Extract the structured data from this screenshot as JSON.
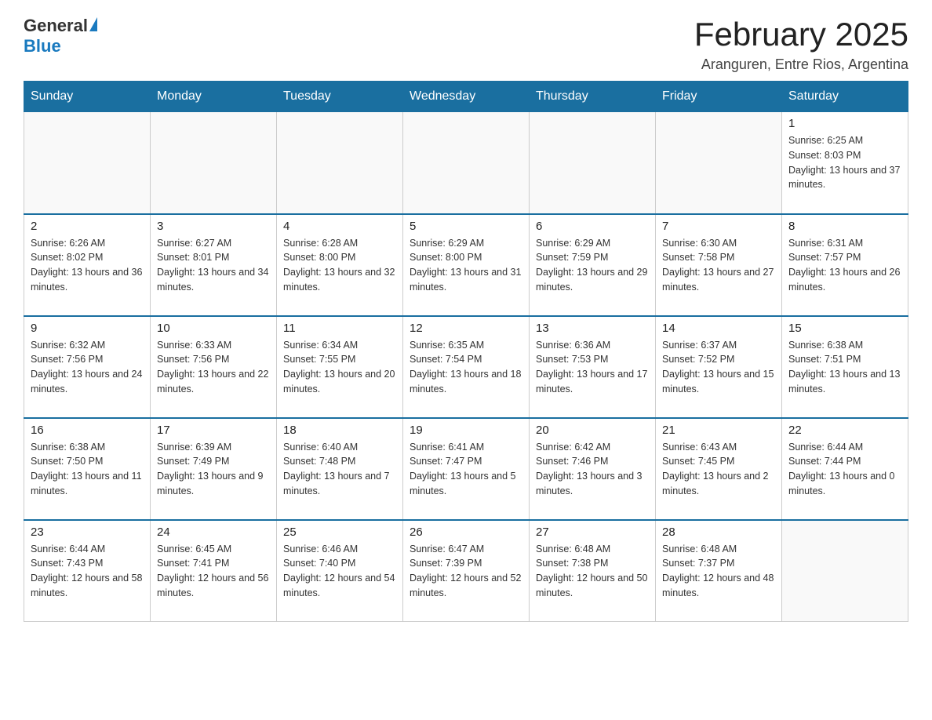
{
  "logo": {
    "general": "General",
    "blue": "Blue"
  },
  "header": {
    "title": "February 2025",
    "location": "Aranguren, Entre Rios, Argentina"
  },
  "weekdays": [
    "Sunday",
    "Monday",
    "Tuesday",
    "Wednesday",
    "Thursday",
    "Friday",
    "Saturday"
  ],
  "weeks": [
    [
      {
        "day": "",
        "info": ""
      },
      {
        "day": "",
        "info": ""
      },
      {
        "day": "",
        "info": ""
      },
      {
        "day": "",
        "info": ""
      },
      {
        "day": "",
        "info": ""
      },
      {
        "day": "",
        "info": ""
      },
      {
        "day": "1",
        "info": "Sunrise: 6:25 AM\nSunset: 8:03 PM\nDaylight: 13 hours and 37 minutes."
      }
    ],
    [
      {
        "day": "2",
        "info": "Sunrise: 6:26 AM\nSunset: 8:02 PM\nDaylight: 13 hours and 36 minutes."
      },
      {
        "day": "3",
        "info": "Sunrise: 6:27 AM\nSunset: 8:01 PM\nDaylight: 13 hours and 34 minutes."
      },
      {
        "day": "4",
        "info": "Sunrise: 6:28 AM\nSunset: 8:00 PM\nDaylight: 13 hours and 32 minutes."
      },
      {
        "day": "5",
        "info": "Sunrise: 6:29 AM\nSunset: 8:00 PM\nDaylight: 13 hours and 31 minutes."
      },
      {
        "day": "6",
        "info": "Sunrise: 6:29 AM\nSunset: 7:59 PM\nDaylight: 13 hours and 29 minutes."
      },
      {
        "day": "7",
        "info": "Sunrise: 6:30 AM\nSunset: 7:58 PM\nDaylight: 13 hours and 27 minutes."
      },
      {
        "day": "8",
        "info": "Sunrise: 6:31 AM\nSunset: 7:57 PM\nDaylight: 13 hours and 26 minutes."
      }
    ],
    [
      {
        "day": "9",
        "info": "Sunrise: 6:32 AM\nSunset: 7:56 PM\nDaylight: 13 hours and 24 minutes."
      },
      {
        "day": "10",
        "info": "Sunrise: 6:33 AM\nSunset: 7:56 PM\nDaylight: 13 hours and 22 minutes."
      },
      {
        "day": "11",
        "info": "Sunrise: 6:34 AM\nSunset: 7:55 PM\nDaylight: 13 hours and 20 minutes."
      },
      {
        "day": "12",
        "info": "Sunrise: 6:35 AM\nSunset: 7:54 PM\nDaylight: 13 hours and 18 minutes."
      },
      {
        "day": "13",
        "info": "Sunrise: 6:36 AM\nSunset: 7:53 PM\nDaylight: 13 hours and 17 minutes."
      },
      {
        "day": "14",
        "info": "Sunrise: 6:37 AM\nSunset: 7:52 PM\nDaylight: 13 hours and 15 minutes."
      },
      {
        "day": "15",
        "info": "Sunrise: 6:38 AM\nSunset: 7:51 PM\nDaylight: 13 hours and 13 minutes."
      }
    ],
    [
      {
        "day": "16",
        "info": "Sunrise: 6:38 AM\nSunset: 7:50 PM\nDaylight: 13 hours and 11 minutes."
      },
      {
        "day": "17",
        "info": "Sunrise: 6:39 AM\nSunset: 7:49 PM\nDaylight: 13 hours and 9 minutes."
      },
      {
        "day": "18",
        "info": "Sunrise: 6:40 AM\nSunset: 7:48 PM\nDaylight: 13 hours and 7 minutes."
      },
      {
        "day": "19",
        "info": "Sunrise: 6:41 AM\nSunset: 7:47 PM\nDaylight: 13 hours and 5 minutes."
      },
      {
        "day": "20",
        "info": "Sunrise: 6:42 AM\nSunset: 7:46 PM\nDaylight: 13 hours and 3 minutes."
      },
      {
        "day": "21",
        "info": "Sunrise: 6:43 AM\nSunset: 7:45 PM\nDaylight: 13 hours and 2 minutes."
      },
      {
        "day": "22",
        "info": "Sunrise: 6:44 AM\nSunset: 7:44 PM\nDaylight: 13 hours and 0 minutes."
      }
    ],
    [
      {
        "day": "23",
        "info": "Sunrise: 6:44 AM\nSunset: 7:43 PM\nDaylight: 12 hours and 58 minutes."
      },
      {
        "day": "24",
        "info": "Sunrise: 6:45 AM\nSunset: 7:41 PM\nDaylight: 12 hours and 56 minutes."
      },
      {
        "day": "25",
        "info": "Sunrise: 6:46 AM\nSunset: 7:40 PM\nDaylight: 12 hours and 54 minutes."
      },
      {
        "day": "26",
        "info": "Sunrise: 6:47 AM\nSunset: 7:39 PM\nDaylight: 12 hours and 52 minutes."
      },
      {
        "day": "27",
        "info": "Sunrise: 6:48 AM\nSunset: 7:38 PM\nDaylight: 12 hours and 50 minutes."
      },
      {
        "day": "28",
        "info": "Sunrise: 6:48 AM\nSunset: 7:37 PM\nDaylight: 12 hours and 48 minutes."
      },
      {
        "day": "",
        "info": ""
      }
    ]
  ]
}
